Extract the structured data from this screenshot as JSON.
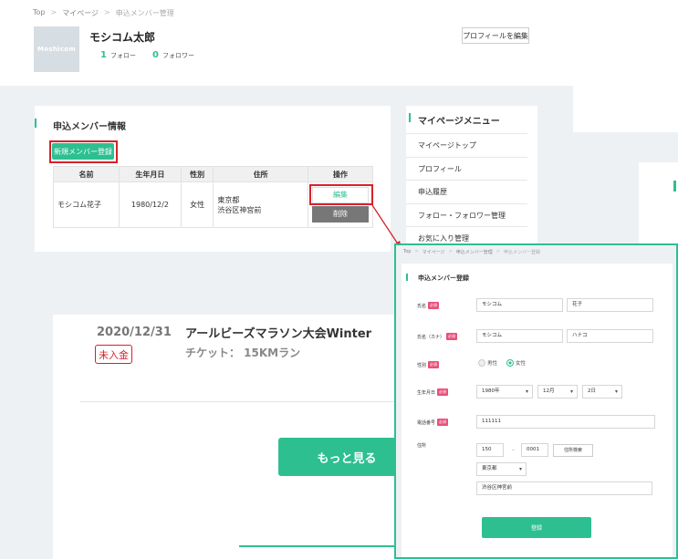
{
  "breadcrumb": [
    "Top",
    "マイページ",
    "申込メンバー管理"
  ],
  "profile": {
    "avatar_text": "Moshicom",
    "name": "モシコム太郎",
    "follow_count": "1",
    "follow_label": "フォロー",
    "follower_count": "0",
    "follower_label": "フォロワー",
    "edit_button": "プロフィールを編集"
  },
  "members": {
    "title": "申込メンバー情報",
    "new_button": "新規メンバー登録",
    "headers": [
      "名前",
      "生年月日",
      "性別",
      "住所",
      "操作"
    ],
    "rows": [
      {
        "name": "モシコム花子",
        "birth": "1980/12/2",
        "gender": "女性",
        "address1": "東京都",
        "address2": "渋谷区神宮前",
        "edit": "編集",
        "delete": "削除"
      }
    ]
  },
  "menu": {
    "title": "マイページメニュー",
    "items": [
      "マイページトップ",
      "プロフィール",
      "申込履歴",
      "フォロー・フォロワー管理",
      "お気に入り管理"
    ]
  },
  "event": {
    "date": "2020/12/31",
    "title": "アールビーズマラソン大会Winter",
    "ticket": "チケット： 15KMラン",
    "status": "未入金",
    "more_button": "もっと見る"
  },
  "form": {
    "breadcrumb": [
      "Top",
      "マイページ",
      "申込メンバー管理",
      "申込メンバー登録"
    ],
    "title": "申込メンバー登録",
    "required": "必須",
    "name_label": "氏名",
    "last_name": "モシコム",
    "first_name": "花子",
    "kana_label": "氏名（カナ）",
    "last_kana": "モシコム",
    "first_kana": "ハナコ",
    "gender_label": "性別",
    "gender_male": "男性",
    "gender_female": "女性",
    "birth_label": "生年月日",
    "birth_year": "1980年",
    "birth_month": "12月",
    "birth_day": "2日",
    "phone_label": "電話番号",
    "phone": "111111",
    "address_label": "住所",
    "zip1": "150",
    "zip2": "0001",
    "zip_search": "住所検索",
    "prefecture": "東京都",
    "city": "渋谷区神宮前",
    "submit": "登録"
  },
  "colors": {
    "accent": "#2ebf91",
    "highlight": "#d8202a",
    "required": "#e8507a"
  }
}
